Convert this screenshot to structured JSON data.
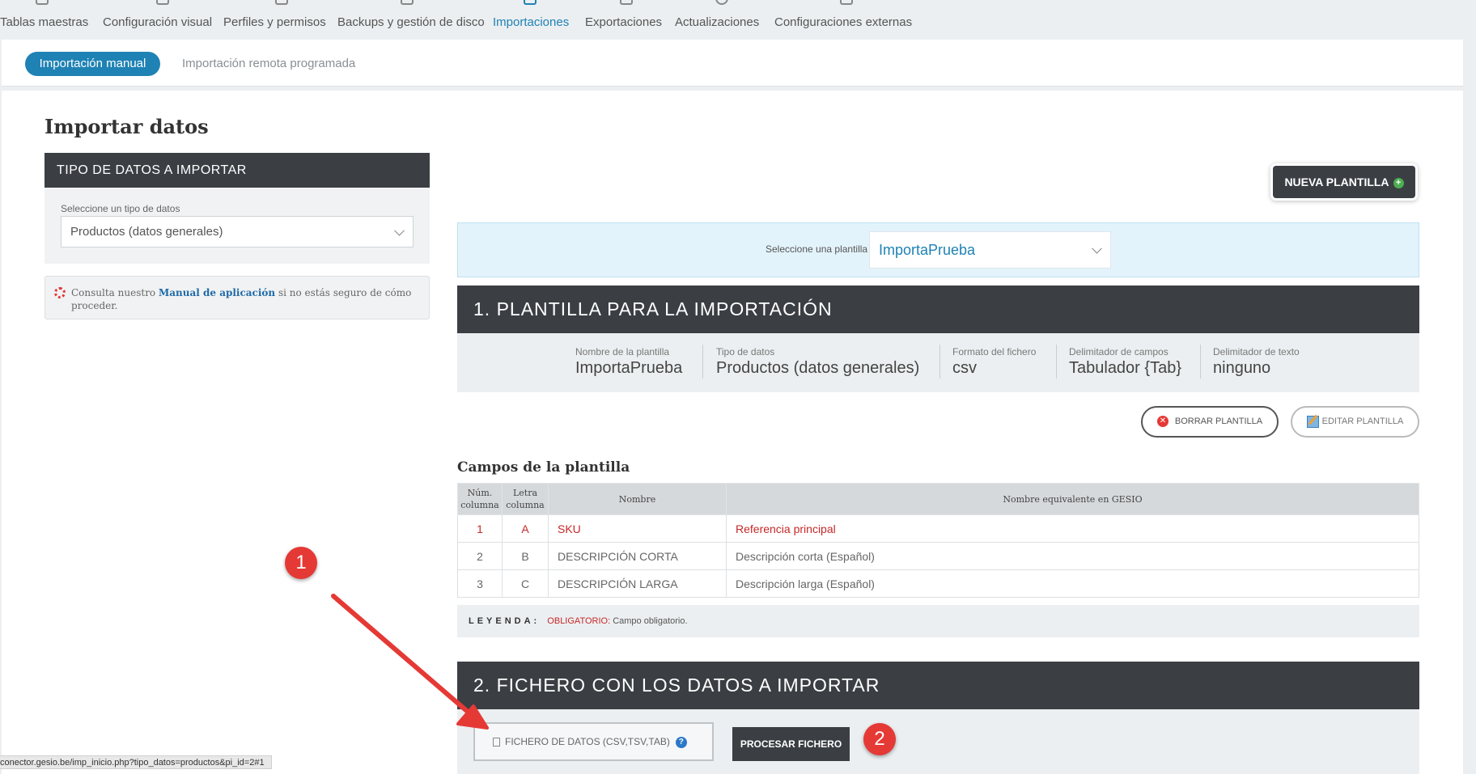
{
  "topnav": {
    "items": [
      {
        "label": "Tablas maestras",
        "icon": "tables-icon"
      },
      {
        "label": "Configuración visual",
        "icon": "brush-icon"
      },
      {
        "label": "Perfiles y permisos",
        "icon": "calendar-icon"
      },
      {
        "label": "Backups y gestión de disco",
        "icon": "backup-icon"
      },
      {
        "label": "Importaciones",
        "icon": "import-icon",
        "active": true
      },
      {
        "label": "Exportaciones",
        "icon": "export-icon"
      },
      {
        "label": "Actualizaciones",
        "icon": "refresh-icon"
      },
      {
        "label": "Configuraciones externas",
        "icon": "puzzle-icon"
      }
    ]
  },
  "subtabs": {
    "active": "Importación manual",
    "inactive": "Importación remota programada"
  },
  "page": {
    "title": "Importar datos"
  },
  "left": {
    "header": "TIPO DE DATOS A IMPORTAR",
    "select_label": "Seleccione un tipo de datos",
    "select_value": "Productos (datos generales)",
    "help_prefix": "Consulta nuestro ",
    "help_link": "Manual de aplicación",
    "help_suffix": " si no estás seguro de cómo proceder."
  },
  "new_template_button": "NUEVA PLANTILLA",
  "template_select": {
    "label": "Seleccione una plantilla",
    "value": "ImportaPrueba"
  },
  "section1": {
    "title": "1. PLANTILLA PARA LA IMPORTACIÓN",
    "info": [
      {
        "k": "Nombre de la plantilla",
        "v": "ImportaPrueba"
      },
      {
        "k": "Tipo de datos",
        "v": "Productos (datos generales)"
      },
      {
        "k": "Formato del fichero",
        "v": "csv"
      },
      {
        "k": "Delimitador de campos",
        "v": "Tabulador {Tab}"
      },
      {
        "k": "Delimitador de texto",
        "v": "ninguno"
      }
    ],
    "delete_button": "BORRAR PLANTILLA",
    "edit_button": "EDITAR PLANTILLA"
  },
  "fields": {
    "title": "Campos de la plantilla",
    "headers": {
      "num_line1": "Núm.",
      "num_line2": "columna",
      "letter_line1": "Letra",
      "letter_line2": "columna",
      "name": "Nombre",
      "equiv": "Nombre equivalente en GESIO"
    },
    "rows": [
      {
        "num": "1",
        "letter": "A",
        "name": "SKU",
        "equiv": "Referencia principal",
        "required": true
      },
      {
        "num": "2",
        "letter": "B",
        "name": "DESCRIPCIÓN CORTA",
        "equiv": "Descripción corta (Español)"
      },
      {
        "num": "3",
        "letter": "C",
        "name": "DESCRIPCIÓN LARGA",
        "equiv": "Descripción larga (Español)"
      }
    ]
  },
  "legend": {
    "label": "LEYENDA:",
    "required": "OBLIGATORIO:",
    "text": " Campo obligatorio."
  },
  "section2": {
    "title": "2. FICHERO CON LOS DATOS A IMPORTAR",
    "file_label": "FICHERO DE DATOS (CSV,TSV,TAB)",
    "process_button": "PROCESAR FICHERO"
  },
  "callouts": [
    "1",
    "2"
  ],
  "status_url": "conector.gesio.be/imp_inicio.php?tipo_datos=productos&pi_id=2#1",
  "colors": {
    "accent": "#1e82b4",
    "dark": "#3b3f44",
    "required": "#c62828",
    "callout": "#e53935"
  }
}
